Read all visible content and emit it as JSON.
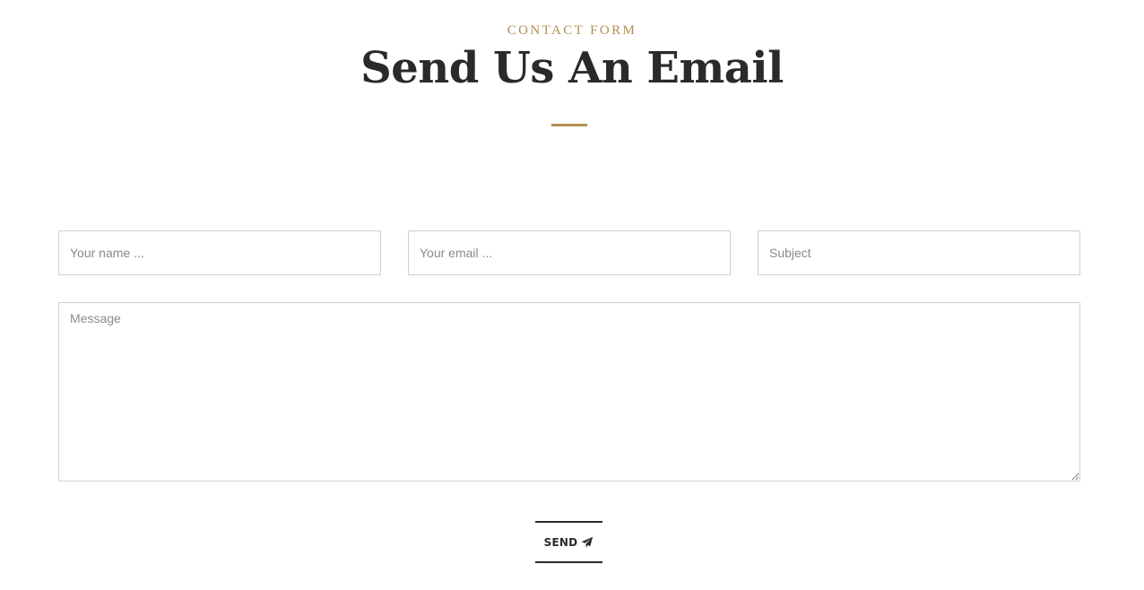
{
  "header": {
    "eyebrow": "CONTACT FORM",
    "title": "Send Us An Email"
  },
  "form": {
    "name_placeholder": "Your name ...",
    "email_placeholder": "Your email ...",
    "subject_placeholder": "Subject",
    "message_placeholder": "Message",
    "send_label": "SEND",
    "send_icon": "paper-plane-icon"
  },
  "colors": {
    "accent": "#b08f50",
    "heading": "#2a2a2a",
    "field_border": "#cfcfcf",
    "placeholder": "#8a8a8a"
  }
}
